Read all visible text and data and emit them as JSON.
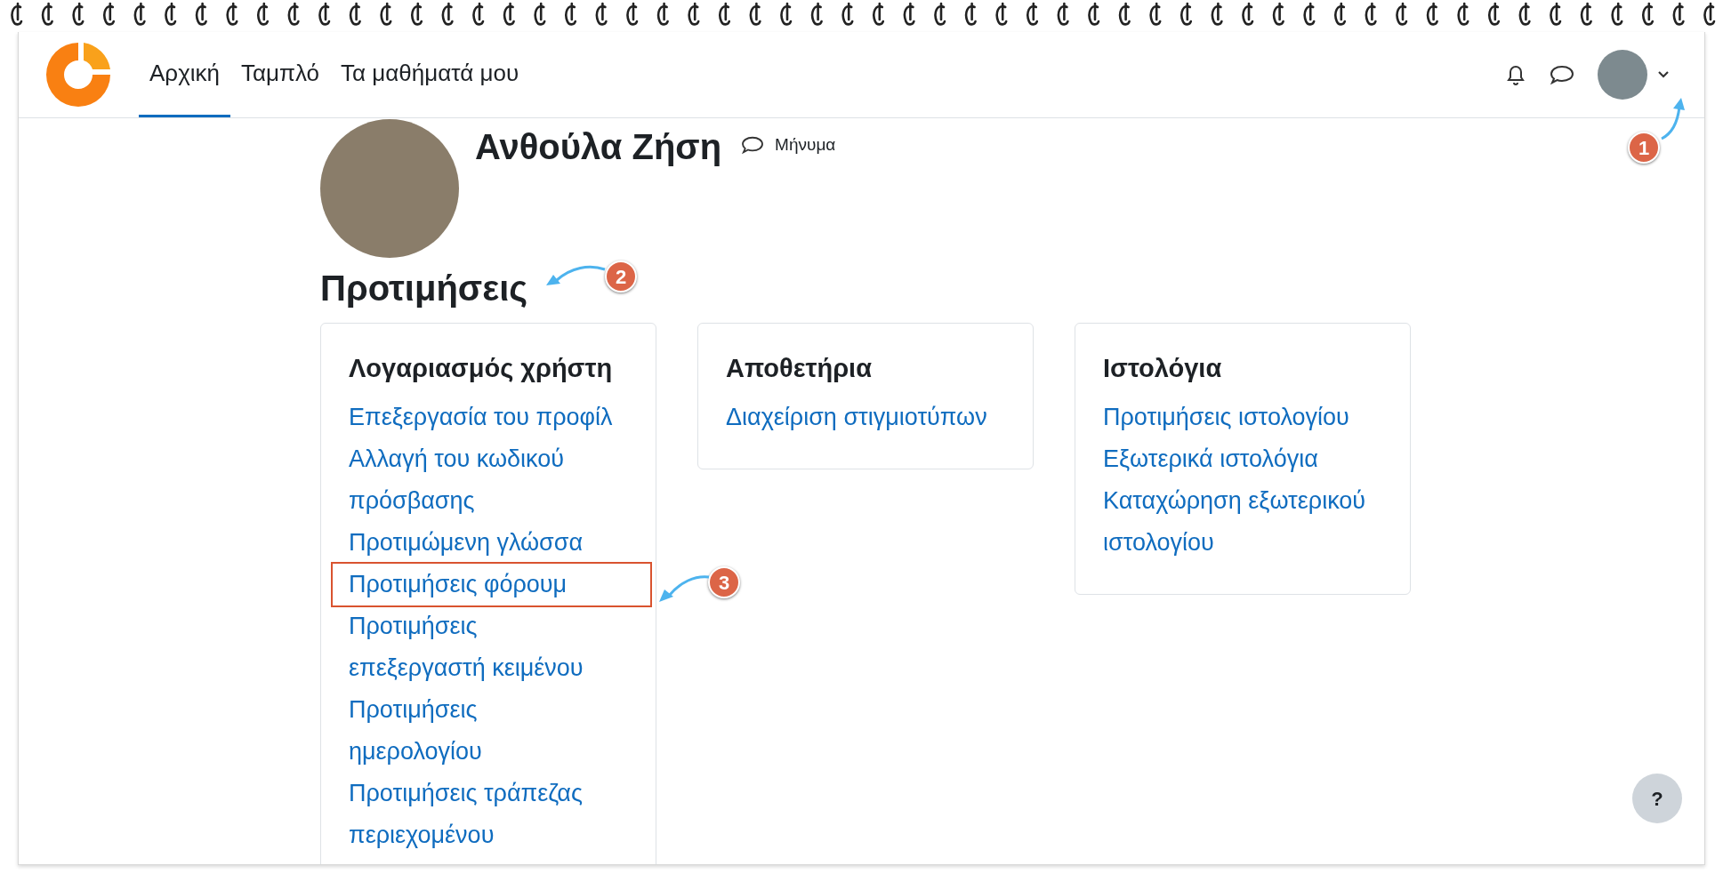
{
  "nav": {
    "items": [
      {
        "label": "Αρχική",
        "selected": true
      },
      {
        "label": "Ταμπλό",
        "selected": false
      },
      {
        "label": "Τα μαθήματά μου",
        "selected": false
      }
    ]
  },
  "profile": {
    "name": "Ανθούλα Ζήση",
    "message_link": "Μήνυμα"
  },
  "heading": "Προτιμήσεις",
  "cards": [
    {
      "title": "Λογαριασμός χρήστη",
      "links": [
        {
          "text": "Επεξεργασία του προφίλ",
          "highlighted": false
        },
        {
          "text": "Αλλαγή του κωδικού πρόσβασης",
          "highlighted": false
        },
        {
          "text": "Προτιμώμενη γλώσσα",
          "highlighted": false
        },
        {
          "text": "Προτιμήσεις φόρουμ",
          "highlighted": true
        },
        {
          "text": "Προτιμήσεις επεξεργαστή κειμένου",
          "highlighted": false
        },
        {
          "text": "Προτιμήσεις ημερολογίου",
          "highlighted": false
        },
        {
          "text": "Προτιμήσεις τράπεζας περιεχομένου",
          "highlighted": false
        }
      ]
    },
    {
      "title": "Αποθετήρια",
      "links": [
        {
          "text": "Διαχείριση στιγμιοτύπων",
          "highlighted": false
        }
      ]
    },
    {
      "title": "Ιστολόγια",
      "links": [
        {
          "text": "Προτιμήσεις ιστολογίου",
          "highlighted": false
        },
        {
          "text": "Εξωτερικά ιστολόγια",
          "highlighted": false
        },
        {
          "text": "Καταχώρηση εξωτερικού ιστολογίου",
          "highlighted": false
        }
      ]
    }
  ],
  "help_button": "?",
  "annotations": [
    {
      "label": "1"
    },
    {
      "label": "2"
    },
    {
      "label": "3"
    }
  ]
}
